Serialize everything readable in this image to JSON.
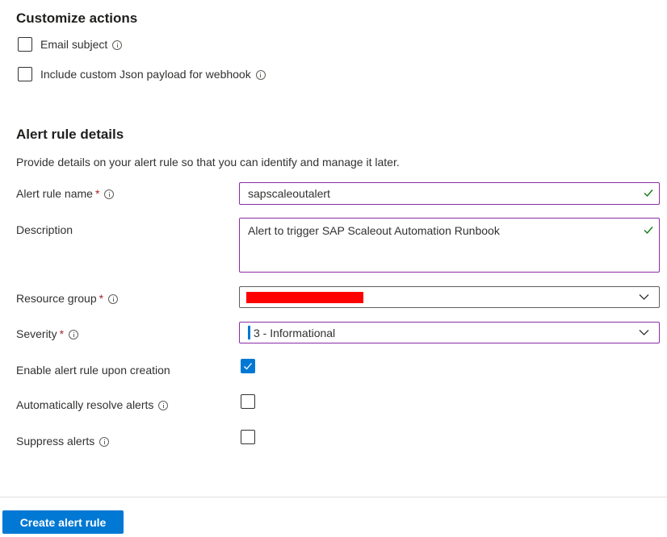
{
  "customize_actions": {
    "title": "Customize actions",
    "email_subject_label": "Email subject",
    "custom_json_label": "Include custom Json payload for webhook"
  },
  "alert_rule_details": {
    "title": "Alert rule details",
    "description_text": "Provide details on your alert rule so that you can identify and manage it later.",
    "alert_rule_name": {
      "label": "Alert rule name",
      "required_mark": "*",
      "value": "sapscaleoutalert"
    },
    "description": {
      "label": "Description",
      "value": "Alert to trigger SAP Scaleout Automation Runbook"
    },
    "resource_group": {
      "label": "Resource group",
      "required_mark": "*",
      "value_redacted": true
    },
    "severity": {
      "label": "Severity",
      "required_mark": "*",
      "value": "3 - Informational"
    },
    "enable_upon_creation": {
      "label": "Enable alert rule upon creation",
      "checked": true
    },
    "auto_resolve": {
      "label": "Automatically resolve alerts",
      "checked": false
    },
    "suppress": {
      "label": "Suppress alerts",
      "checked": false
    }
  },
  "footer": {
    "create_button_label": "Create alert rule"
  },
  "colors": {
    "accent": "#0078d4",
    "focus_border": "#8a2da5",
    "success_check": "#107c10",
    "required": "#a4262c",
    "redaction": "#ff0000"
  },
  "icons": {
    "info": "info-icon",
    "valid": "checkmark-icon",
    "dropdown": "chevron-down-icon"
  }
}
